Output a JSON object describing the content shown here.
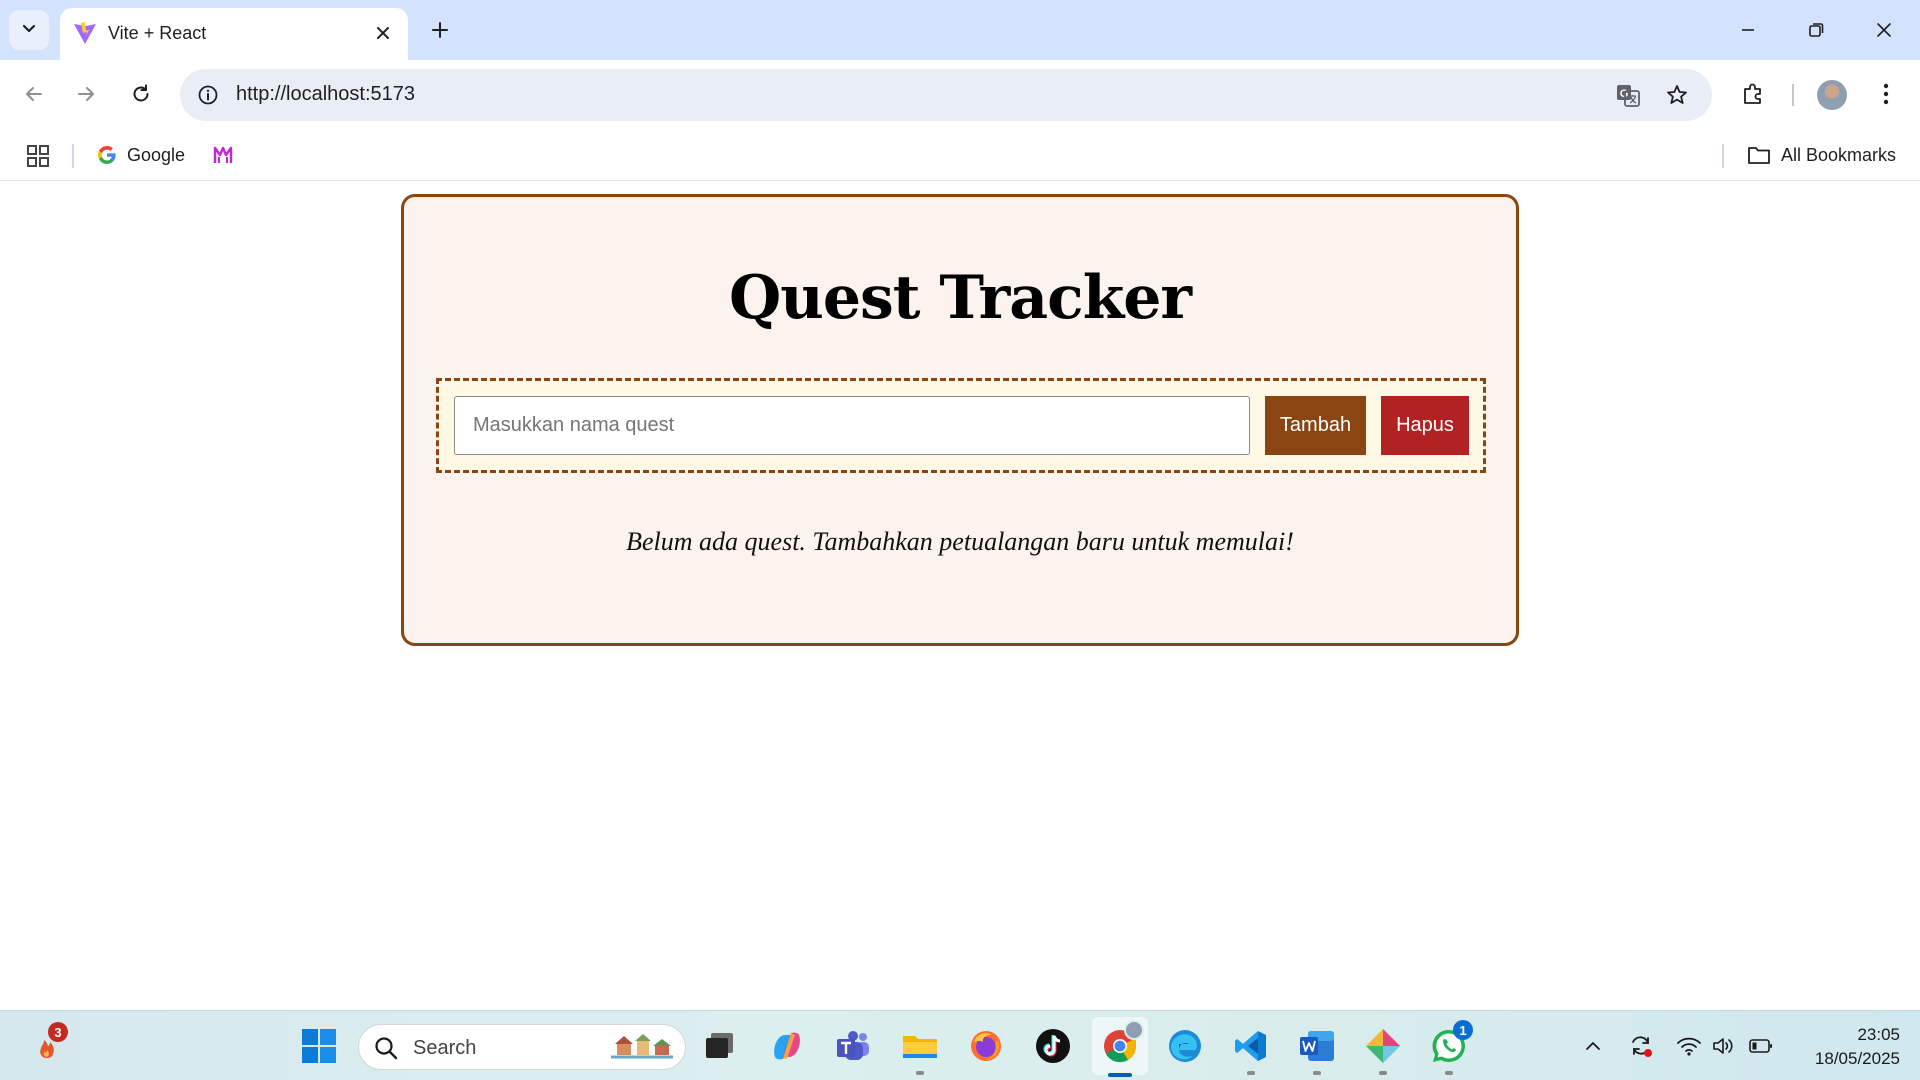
{
  "browser": {
    "tab": {
      "title": "Vite + React"
    },
    "address": {
      "url": "http://localhost:5173"
    },
    "bookmarks": [
      {
        "label": "Google",
        "icon": "google-icon"
      },
      {
        "label": "",
        "icon": "bookmark-logo-icon"
      }
    ],
    "all_bookmarks_label": "All Bookmarks"
  },
  "app": {
    "title": "Quest Tracker",
    "input_placeholder": "Masukkan nama quest",
    "input_value": "",
    "add_label": "Tambah",
    "delete_label": "Hapus",
    "empty_message": "Belum ada quest. Tambahkan petualangan baru untuk memulai!",
    "colors": {
      "border": "#8b4513",
      "card_bg": "#fdf3ee",
      "form_bg": "#fff8e4",
      "add_button": "#8b4513",
      "delete_button": "#b22222"
    }
  },
  "taskbar": {
    "search_label": "Search",
    "widget_badge": "3",
    "whatsapp_badge": "1",
    "time": "23:05",
    "date": "18/05/2025"
  }
}
